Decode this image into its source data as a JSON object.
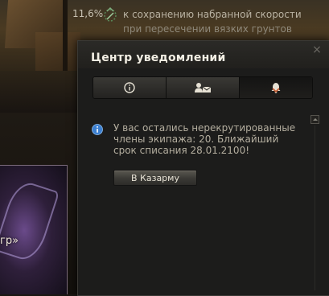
{
  "background": {
    "card_text": "гр»"
  },
  "top_hint": {
    "percent": "11,6%",
    "icon": "speed-retention-icon",
    "line1": "к сохранению набранной скорости",
    "line2": "при пересечении вязких грунтов"
  },
  "panel": {
    "title": "Центр уведомлений",
    "close_glyph": "×",
    "tabs": [
      {
        "icon": "info-icon",
        "active": false
      },
      {
        "icon": "personal-message-icon",
        "active": false
      },
      {
        "icon": "bell-icon",
        "active": true
      }
    ],
    "notification": {
      "icon": "info-circle-icon",
      "text": "У вас остались нерекрутированные члены экипажа: 20. Ближайший срок списания 28.01.2100!",
      "button_label": "В Казарму"
    }
  },
  "colors": {
    "accent_active_chevron": "#c4562a",
    "info_icon_blue": "#3c7fd0"
  }
}
